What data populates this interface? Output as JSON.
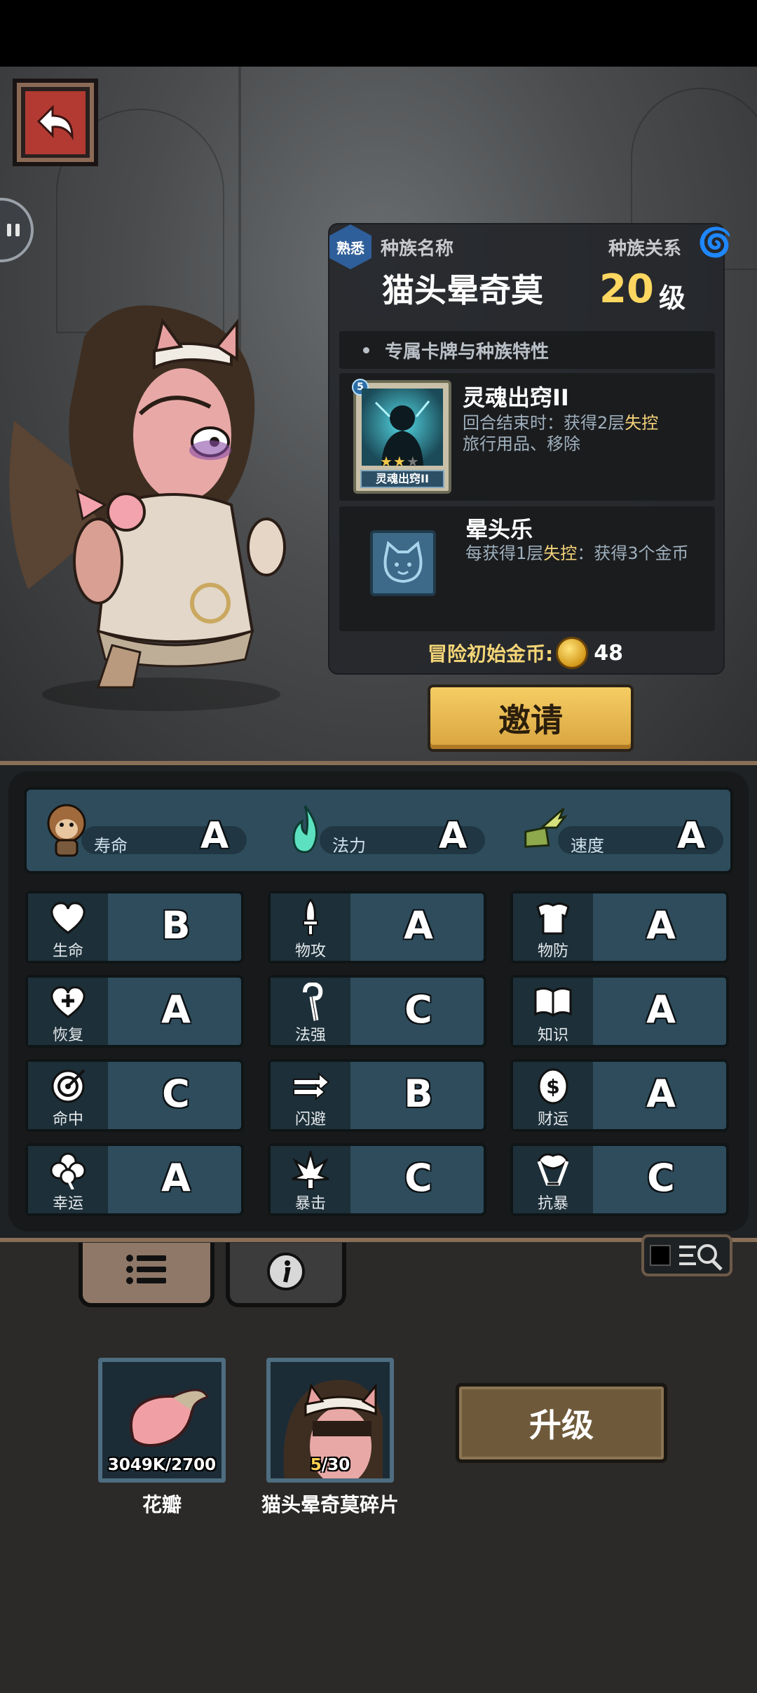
{
  "header": {
    "familiar_badge": "熟悉",
    "race_name_label": "种族名称",
    "race_relation_label": "种族关系",
    "race_name": "猫头晕奇莫",
    "level": "20",
    "level_unit": "级"
  },
  "traits": {
    "section_title": "专属卡牌与种族特性",
    "card": {
      "title": "灵魂出窍II",
      "caption": "灵魂出窍II",
      "card_level": "5",
      "stars_filled": 2,
      "stars_total": 3,
      "desc_prefix": "回合结束时：获得2层",
      "desc_highlight": "失控",
      "desc_line2": "旅行用品、移除"
    },
    "trait": {
      "title": "晕头乐",
      "desc_prefix": "每获得1层",
      "desc_highlight": "失控",
      "desc_suffix": "：获得3个金币"
    }
  },
  "gold": {
    "label": "冒险初始金币:",
    "value": "48"
  },
  "invite_label": "邀请",
  "top_stats": [
    {
      "name": "寿命",
      "grade": "A",
      "icon": "monkey-head-icon"
    },
    {
      "name": "法力",
      "grade": "A",
      "icon": "flame-icon"
    },
    {
      "name": "速度",
      "grade": "A",
      "icon": "winged-boot-icon"
    }
  ],
  "stats": [
    {
      "name": "生命",
      "grade": "B",
      "icon": "heart-icon"
    },
    {
      "name": "物攻",
      "grade": "A",
      "icon": "sword-icon"
    },
    {
      "name": "物防",
      "grade": "A",
      "icon": "armor-icon"
    },
    {
      "name": "恢复",
      "grade": "A",
      "icon": "heart-plus-icon"
    },
    {
      "name": "法强",
      "grade": "C",
      "icon": "staff-icon"
    },
    {
      "name": "知识",
      "grade": "A",
      "icon": "book-icon"
    },
    {
      "name": "命中",
      "grade": "C",
      "icon": "target-icon"
    },
    {
      "name": "闪避",
      "grade": "B",
      "icon": "dash-arrows-icon"
    },
    {
      "name": "财运",
      "grade": "A",
      "icon": "coin-icon"
    },
    {
      "name": "幸运",
      "grade": "A",
      "icon": "clover-icon"
    },
    {
      "name": "暴击",
      "grade": "C",
      "icon": "crit-burst-icon"
    },
    {
      "name": "抗暴",
      "grade": "C",
      "icon": "shield-flower-icon"
    }
  ],
  "tabs": [
    {
      "name": "list",
      "icon": "list-icon",
      "active": true
    },
    {
      "name": "info",
      "icon": "info-icon",
      "active": false
    }
  ],
  "items": [
    {
      "label": "花瓣",
      "qty": "3049K/2700",
      "icon": "petal-icon"
    },
    {
      "label": "猫头晕奇莫碎片",
      "qty_current": "5",
      "qty_total": "/30",
      "icon": "character-portrait-icon"
    }
  ],
  "upgrade_label": "升级",
  "colors": {
    "gold_text": "#f4d577",
    "level_yellow": "#ffd760",
    "invite_button": "#f0c35a",
    "stat_cell": "#2e4c5c",
    "highlight": "#f3d279",
    "back_button_red": "#b23a32"
  }
}
